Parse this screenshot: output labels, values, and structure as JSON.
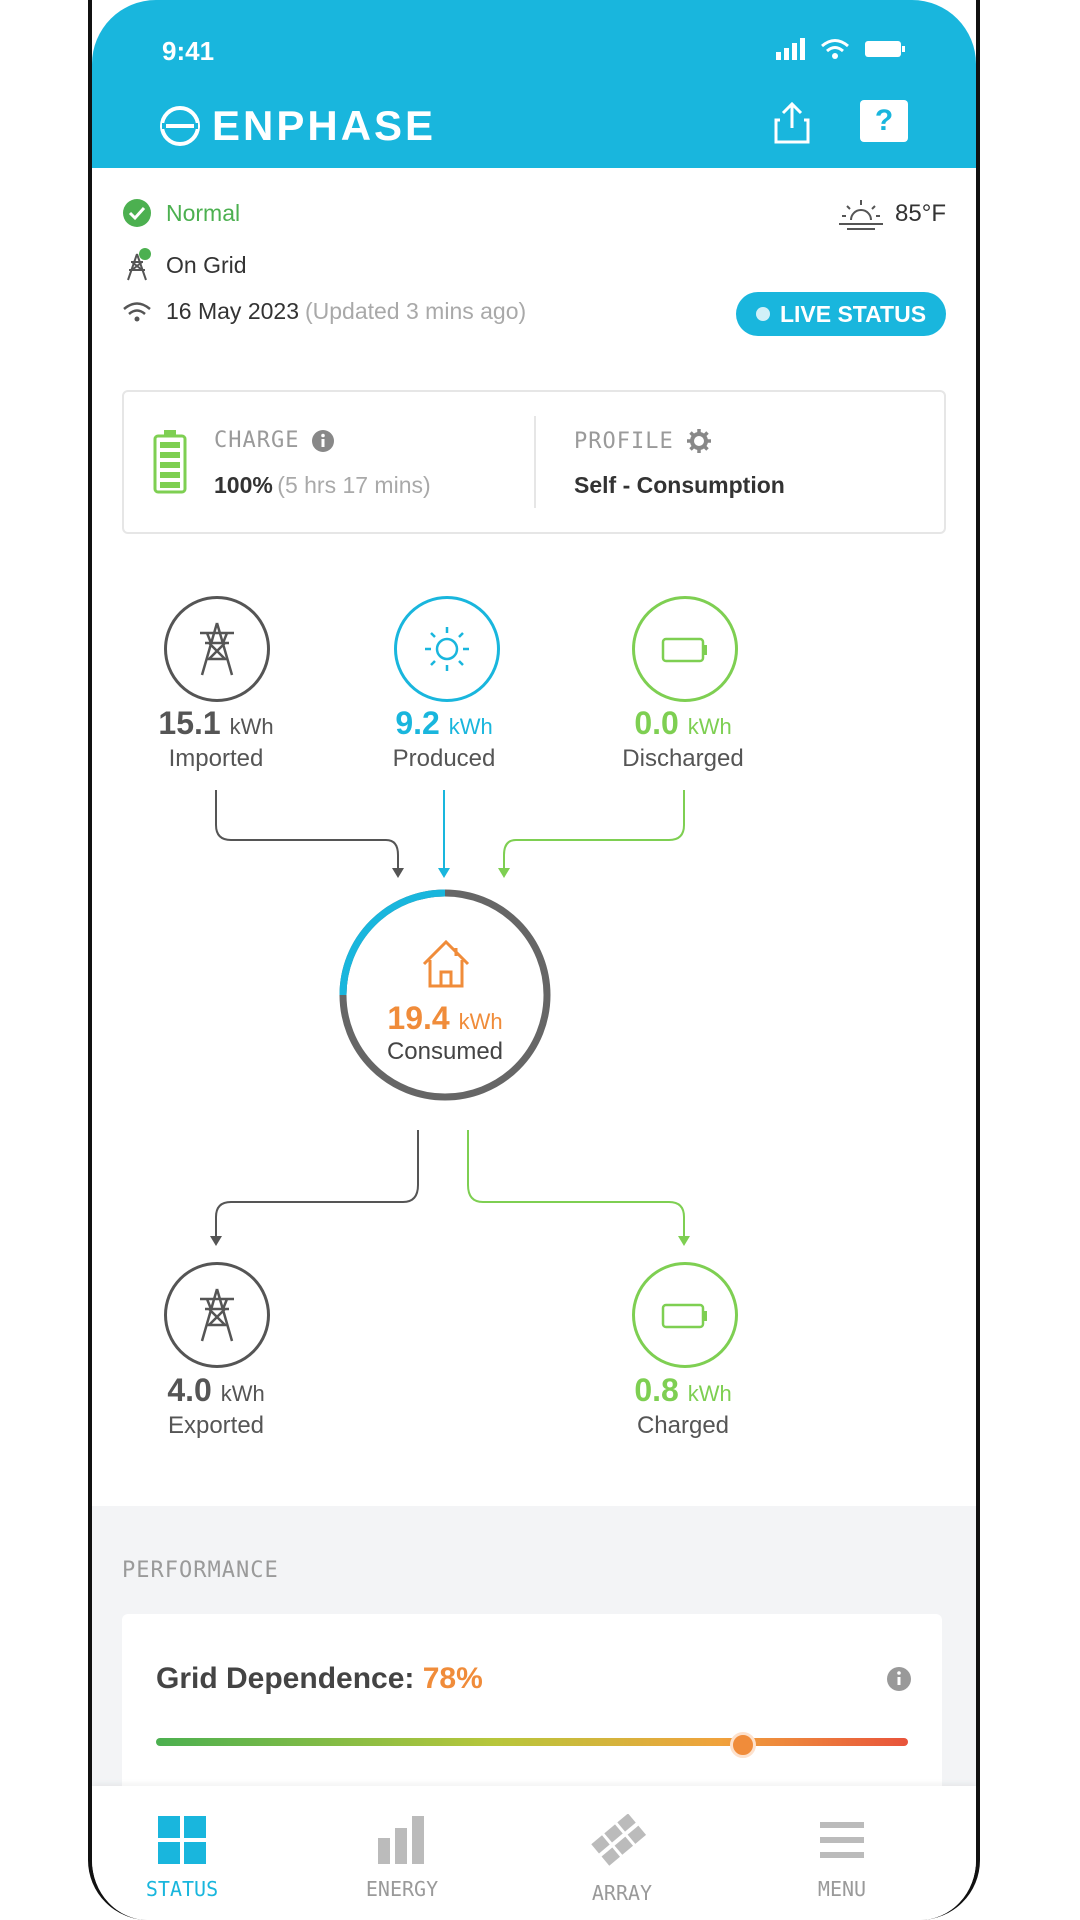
{
  "status_bar": {
    "time": "9:41"
  },
  "header": {
    "brand": "ENPHASE"
  },
  "system": {
    "status": "Normal",
    "grid": "On Grid",
    "date": "16 May 2023",
    "updated": "(Updated 3 mins ago)",
    "temperature": "85°F",
    "live_status_label": "LIVE STATUS"
  },
  "battery_card": {
    "charge_label": "CHARGE",
    "charge_value": "100%",
    "charge_time": "(5 hrs 17 mins)",
    "profile_label": "PROFILE",
    "profile_value": "Self - Consumption"
  },
  "energy": {
    "imported": {
      "value": "15.1",
      "unit": "kWh",
      "label": "Imported"
    },
    "produced": {
      "value": "9.2",
      "unit": "kWh",
      "label": "Produced"
    },
    "discharged": {
      "value": "0.0",
      "unit": "kWh",
      "label": "Discharged"
    },
    "consumed": {
      "value": "19.4",
      "unit": "kWh",
      "label": "Consumed",
      "solar_fraction": 0.25
    },
    "exported": {
      "value": "4.0",
      "unit": "kWh",
      "label": "Exported"
    },
    "charged": {
      "value": "0.8",
      "unit": "kWh",
      "label": "Charged"
    }
  },
  "performance": {
    "section_title": "PERFORMANCE",
    "grid_dependence_label": "Grid Dependence:",
    "grid_dependence_value": "78%",
    "grid_dependence_fraction": 0.78
  },
  "nav": [
    {
      "label": "STATUS",
      "icon": "grid-icon",
      "active": true
    },
    {
      "label": "ENERGY",
      "icon": "bar-chart-icon",
      "active": false
    },
    {
      "label": "ARRAY",
      "icon": "solar-array-icon",
      "active": false
    },
    {
      "label": "MENU",
      "icon": "hamburger-icon",
      "active": false
    }
  ],
  "colors": {
    "accent": "#19b6dd",
    "normal": "#4cb050",
    "battery": "#7ecf52",
    "consumed": "#f08c3a",
    "grid": "#555555"
  }
}
